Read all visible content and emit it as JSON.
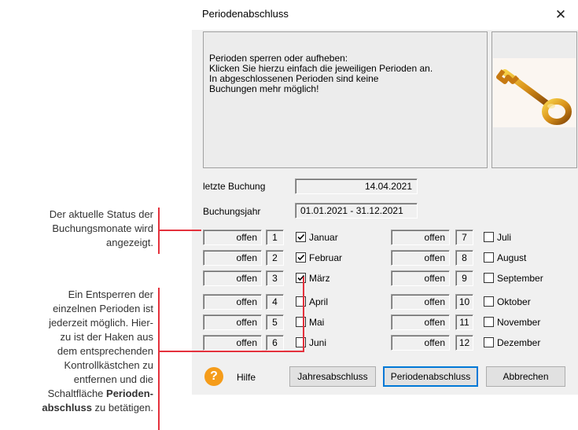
{
  "dialog": {
    "title": "Periodenabschluss",
    "close_glyph": "✕",
    "info_text": "Perioden sperren oder aufheben:\nKlicken Sie hierzu einfach die jeweiligen Perioden an.\nIn abgeschlossenen Perioden sind keine\nBuchungen mehr möglich!",
    "image_icon": "key-icon",
    "last_booking_label": "letzte Buchung",
    "last_booking_value": "14.04.2021",
    "fiscal_year_label": "Buchungsjahr",
    "fiscal_year_value": "01.01.2021 - 31.12.2021",
    "months_left": [
      {
        "status": "offen",
        "num": "1",
        "label": "Januar",
        "checked": true
      },
      {
        "status": "offen",
        "num": "2",
        "label": "Februar",
        "checked": true
      },
      {
        "status": "offen",
        "num": "3",
        "label": "März",
        "checked": true
      },
      {
        "status": "offen",
        "num": "4",
        "label": "April",
        "checked": false
      },
      {
        "status": "offen",
        "num": "5",
        "label": "Mai",
        "checked": false
      },
      {
        "status": "offen",
        "num": "6",
        "label": "Juni",
        "checked": false
      }
    ],
    "months_right": [
      {
        "status": "offen",
        "num": "7",
        "label": "Juli",
        "checked": false
      },
      {
        "status": "offen",
        "num": "8",
        "label": "August",
        "checked": false
      },
      {
        "status": "offen",
        "num": "9",
        "label": "September",
        "checked": false
      },
      {
        "status": "offen",
        "num": "10",
        "label": "Oktober",
        "checked": false
      },
      {
        "status": "offen",
        "num": "11",
        "label": "November",
        "checked": false
      },
      {
        "status": "offen",
        "num": "12",
        "label": "Dezember",
        "checked": false
      }
    ],
    "help_glyph": "?",
    "help_label": "Hilfe",
    "buttons": {
      "year_end": "Jahresabschluss",
      "period_end": "Periodenabschluss",
      "cancel": "Abbrechen"
    }
  },
  "annotations": {
    "status": "Der aktuelle Status der\nBuchungsmonate wird\nangezeigt.",
    "unlock_plain": "Ein Entsperren der\neinzelnen Perioden ist\njederzeit möglich. Hier-\nzu ist der Haken aus\ndem entsprechenden\nKontrollkästchen zu\nentfernen und die\nSchaltfläche ",
    "unlock_bold_1": "Perioden-",
    "unlock_bold_2": "abschluss",
    "unlock_tail": " zu betätigen."
  },
  "colors": {
    "annotation_line": "#e4313c",
    "help_icon": "#f59c1a",
    "dialog_bg": "#f0f0f0"
  }
}
